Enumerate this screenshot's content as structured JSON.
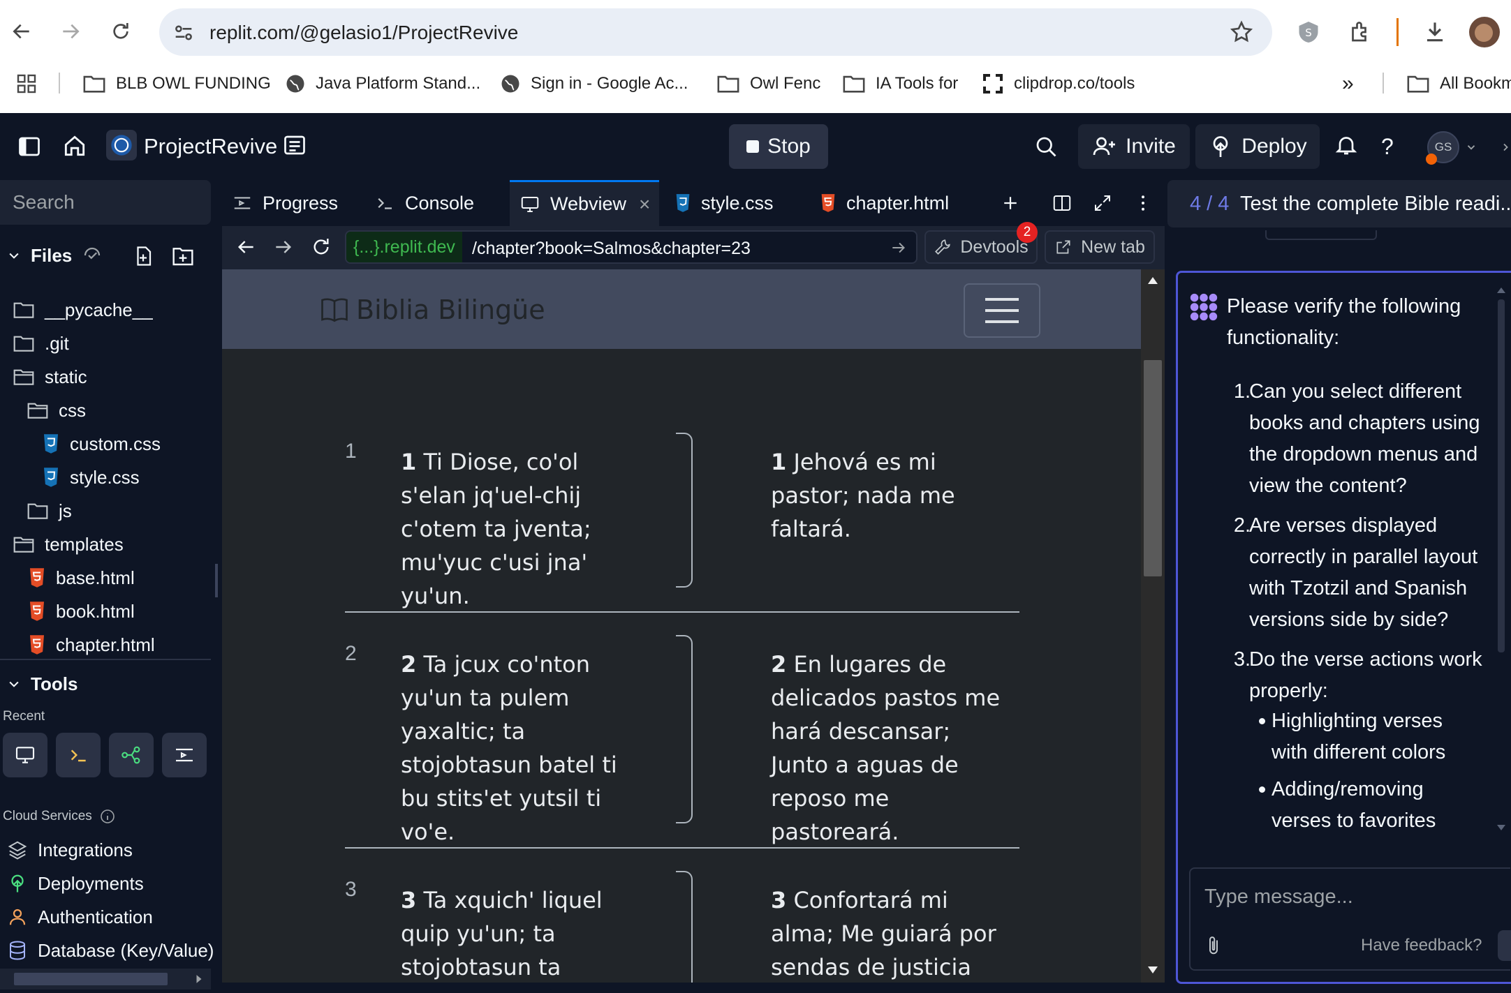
{
  "browser": {
    "url": "replit.com/@gelasio1/ProjectRevive",
    "bookmarks": [
      {
        "label": "BLB OWL FUNDING",
        "icon": "folder-icon"
      },
      {
        "label": "Java Platform Stand...",
        "icon": "globe-icon"
      },
      {
        "label": "Sign in - Google Ac...",
        "icon": "globe-icon"
      },
      {
        "label": "Owl Fenc",
        "icon": "folder-icon"
      },
      {
        "label": "IA Tools for",
        "icon": "folder-icon"
      },
      {
        "label": "clipdrop.co/tools",
        "icon": "clipdrop-icon"
      }
    ],
    "all_bookmarks_label": "All Bookm",
    "overflow_label": "»"
  },
  "header": {
    "project_name": "ProjectRevive",
    "stop_label": "Stop",
    "invite_label": "Invite",
    "deploy_label": "Deploy",
    "help_label": "?",
    "avatar_initials": "GS"
  },
  "sidebar": {
    "search_placeholder": "Search",
    "files_label": "Files",
    "tree": [
      {
        "label": "__pycache__",
        "type": "folder"
      },
      {
        "label": ".git",
        "type": "folder"
      },
      {
        "label": "static",
        "type": "folder"
      },
      {
        "label": "css",
        "type": "folder"
      },
      {
        "label": "custom.css",
        "type": "css"
      },
      {
        "label": "style.css",
        "type": "css"
      },
      {
        "label": "js",
        "type": "folder"
      },
      {
        "label": "templates",
        "type": "folder"
      },
      {
        "label": "base.html",
        "type": "html"
      },
      {
        "label": "book.html",
        "type": "html"
      },
      {
        "label": "chapter.html",
        "type": "html"
      }
    ],
    "tools_label": "Tools",
    "recent_label": "Recent",
    "cloud_services_label": "Cloud Services",
    "services": [
      {
        "label": "Integrations",
        "icon": "layers-icon"
      },
      {
        "label": "Deployments",
        "icon": "deploy-icon"
      },
      {
        "label": "Authentication",
        "icon": "user-icon"
      },
      {
        "label": "Database (Key/Value)",
        "icon": "database-icon"
      }
    ]
  },
  "tabs": [
    {
      "label": "Progress",
      "icon": "progress-icon"
    },
    {
      "label": "Console",
      "icon": "terminal-icon"
    },
    {
      "label": "Webview",
      "icon": "monitor-icon",
      "close": "×"
    },
    {
      "label": "style.css",
      "icon": "css-icon"
    },
    {
      "label": "chapter.html",
      "icon": "html-icon"
    }
  ],
  "webview": {
    "domain": "{...}.replit.dev",
    "path": "/chapter?book=Salmos&chapter=23",
    "devtools_label": "Devtools",
    "devtools_badge": "2",
    "newtab_label": "New tab",
    "brand": "Biblia Bilingüe",
    "verses": [
      {
        "num": "1",
        "tzotzil_num": "1",
        "tzotzil": "Ti Diose, co'ol s'elan jq'uel-chij c'otem ta jventa; mu'yuc c'usi jna' yu'un.",
        "spanish_num": "1",
        "spanish": "Jehová es mi pastor; nada me faltará."
      },
      {
        "num": "2",
        "tzotzil_num": "2",
        "tzotzil": "Ta jcux co'nton yu'un ta pulem yaxaltic; ta stojobtasun batel ti bu stits'et yutsil ti vo'e.",
        "spanish_num": "2",
        "spanish": "En lugares de delicados pastos me hará descansar; Junto a aguas de reposo me pastoreará."
      },
      {
        "num": "3",
        "tzotzil_num": "3",
        "tzotzil": "Ta xquich' liquel quip yu'un; ta stojobtasun ta stamel ti tsc'uil",
        "spanish_num": "3",
        "spanish": "Confortará mi alma; Me guiará por sendas de justicia por amor de"
      }
    ]
  },
  "agent": {
    "step": "4 / 4",
    "step_title": "Test the complete Bible readi...",
    "intro": "Please verify the following functionality:",
    "items": [
      {
        "num": "1.",
        "text": "Can you select different books and chapters using the dropdown menus and view the content?"
      },
      {
        "num": "2.",
        "text": "Are verses displayed correctly in parallel layout with Tzotzil and Spanish versions side by side?"
      },
      {
        "num": "3.",
        "text": "Do the verse actions work properly:"
      }
    ],
    "subitems": [
      "Highlighting verses with different colors",
      "Adding/removing verses to favorites"
    ],
    "input_placeholder": "Type message...",
    "feedback_label": "Have feedback?"
  },
  "colors": {
    "accent_blue": "#0079f2",
    "agent_border": "#4e56d6",
    "badge_red": "#e52222",
    "domain_green": "#3fb950"
  }
}
